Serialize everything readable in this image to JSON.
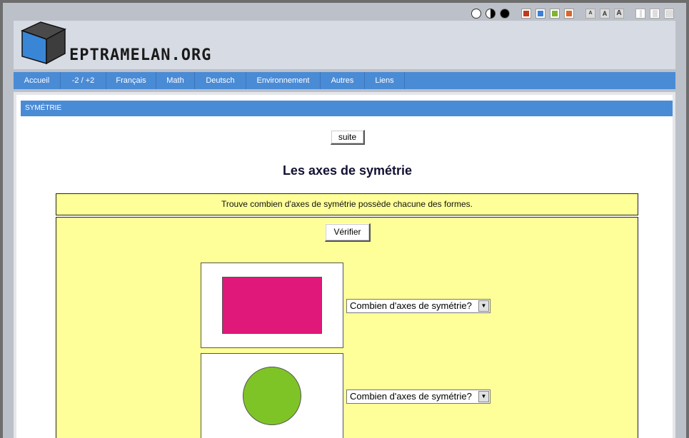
{
  "site": {
    "logo_text": "EPTRAMELAN.ORG"
  },
  "toolbar": {
    "contrast_icons": [
      "contrast-white-icon",
      "contrast-half-icon",
      "contrast-black-icon"
    ],
    "color_swatches": [
      "#c0391b",
      "#3d7fd6",
      "#7eb530",
      "#d9662a"
    ],
    "font_sizes": [
      "A",
      "A",
      "A"
    ]
  },
  "nav": {
    "items": [
      {
        "label": "Accueil"
      },
      {
        "label": "-2 / +2"
      },
      {
        "label": "Français"
      },
      {
        "label": "Math"
      },
      {
        "label": "Deutsch"
      },
      {
        "label": "Environnement"
      },
      {
        "label": "Autres"
      },
      {
        "label": "Liens"
      }
    ]
  },
  "breadcrumb": "SYMÉTRIE",
  "buttons": {
    "next": "suite",
    "check": "Vérifier"
  },
  "page": {
    "title": "Les axes de symétrie",
    "instruction": "Trouve combien d'axes de symétrie possède chacune des formes."
  },
  "shapes": [
    {
      "kind": "rectangle",
      "color": "#e0187a",
      "select_value": "Combien d'axes de symétrie?"
    },
    {
      "kind": "circle",
      "color": "#7fc427",
      "select_value": "Combien d'axes de symétrie?"
    }
  ]
}
